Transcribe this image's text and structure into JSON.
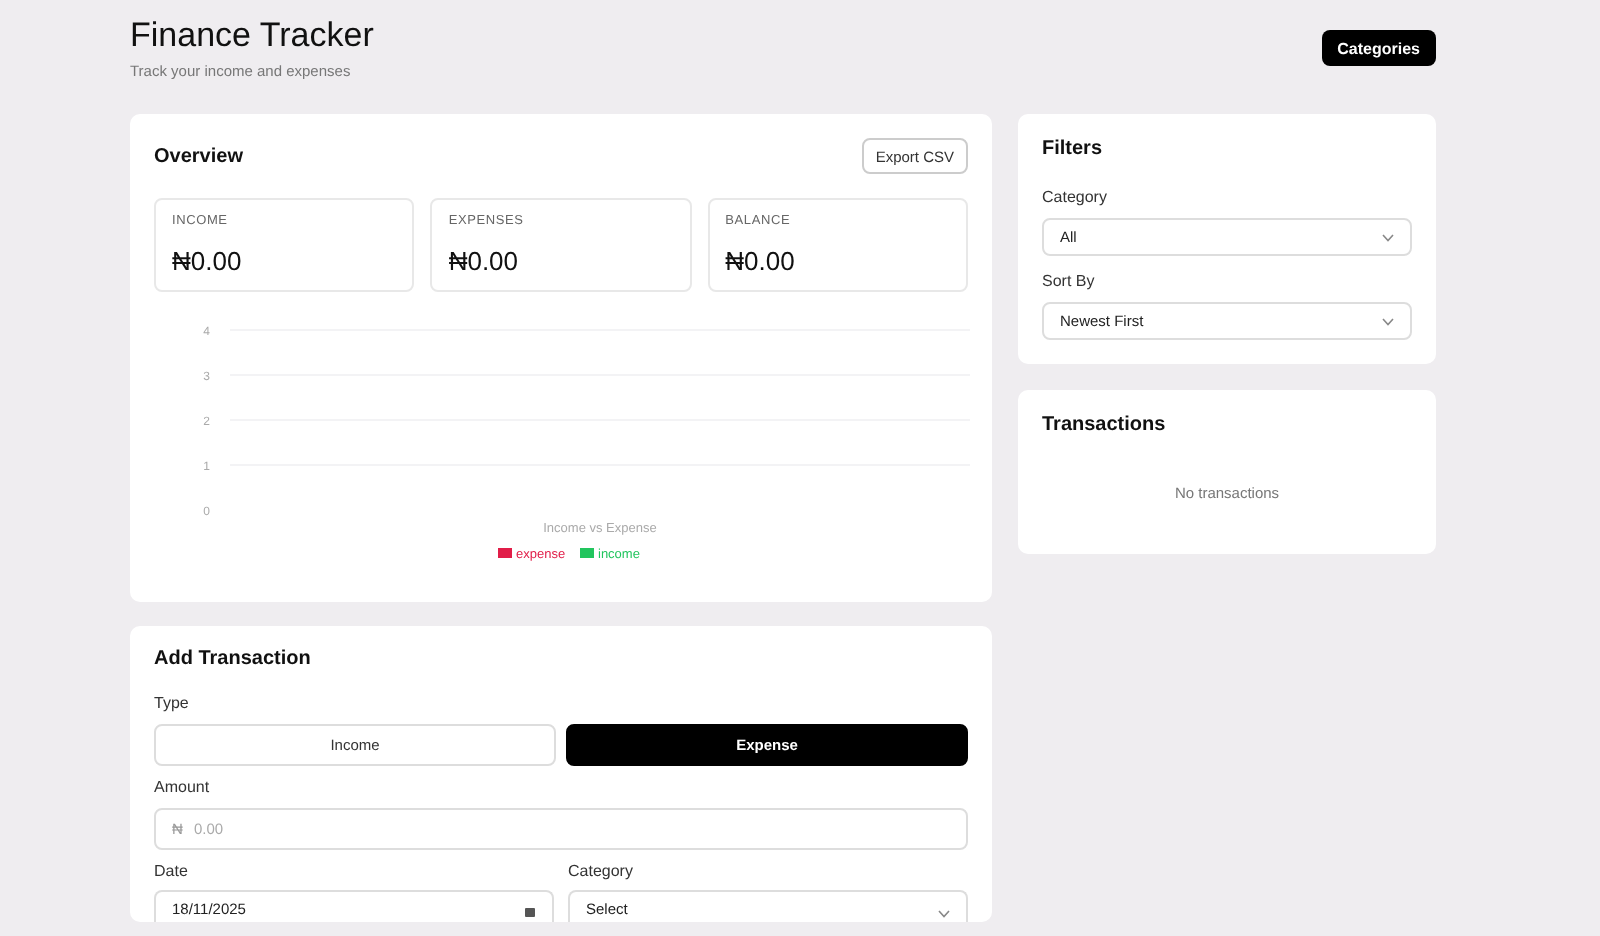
{
  "header": {
    "title": "Finance Tracker",
    "subtitle": "Track your income and expenses",
    "button": "Categories"
  },
  "overview": {
    "title": "Overview",
    "export_button": "Export CSV",
    "stats": [
      {
        "label": "INCOME",
        "value": "₦0.00"
      },
      {
        "label": "EXPENSES",
        "value": "₦0.00"
      },
      {
        "label": "BALANCE",
        "value": "₦0.00"
      }
    ],
    "chart_data": {
      "type": "bar",
      "title": "Income vs Expense",
      "yticks": [
        0,
        1,
        2,
        3,
        4
      ],
      "grid": true,
      "ylim": [
        0,
        4
      ],
      "series": [
        {
          "name": "expense",
          "color": "#e11d48"
        },
        {
          "name": "income",
          "color": "#22c55e"
        }
      ]
    }
  },
  "filters": {
    "title": "Filters",
    "fields": [
      {
        "label": "Category",
        "value": "All"
      },
      {
        "label": "Sort By",
        "value": "Newest First"
      }
    ]
  },
  "transactions": {
    "title": "Transactions",
    "empty_text": "No transactions"
  },
  "add_transaction": {
    "title": "Add Transaction",
    "type_label": "Type",
    "types": [
      {
        "label": "Income",
        "selected": false
      },
      {
        "label": "Expense",
        "selected": true
      }
    ],
    "amount": {
      "label": "Amount",
      "prefix": "₦",
      "placeholder": "0.00"
    },
    "date": {
      "label": "Date",
      "value": "18/11/2025"
    },
    "category": {
      "label": "Category",
      "value": "Select"
    }
  }
}
